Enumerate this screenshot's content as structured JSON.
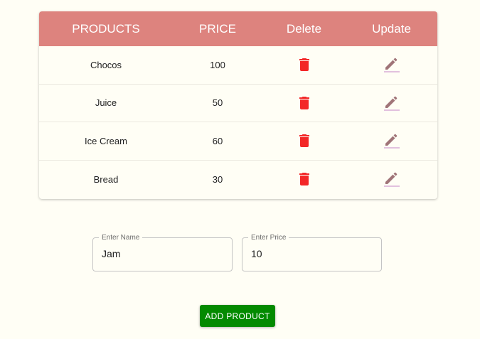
{
  "table": {
    "headers": [
      "PRODUCTS",
      "PRICE",
      "Delete",
      "Update"
    ],
    "rows": [
      {
        "name": "Chocos",
        "price": "100"
      },
      {
        "name": "Juice",
        "price": "50"
      },
      {
        "name": "Ice Cream",
        "price": "60"
      },
      {
        "name": "Bread",
        "price": "30"
      }
    ],
    "delete_icon": "trash-icon",
    "update_icon": "pencil-icon"
  },
  "form": {
    "name_label": "Enter Name",
    "name_value": "Jam",
    "price_label": "Enter Price",
    "price_value": "10"
  },
  "add_button_label": "ADD PRODUCT",
  "colors": {
    "header_bg": "#dd837e",
    "delete_icon": "#f32727",
    "update_icon": "#a07478",
    "button_bg": "#038a00",
    "page_bg": "#fffef5"
  }
}
